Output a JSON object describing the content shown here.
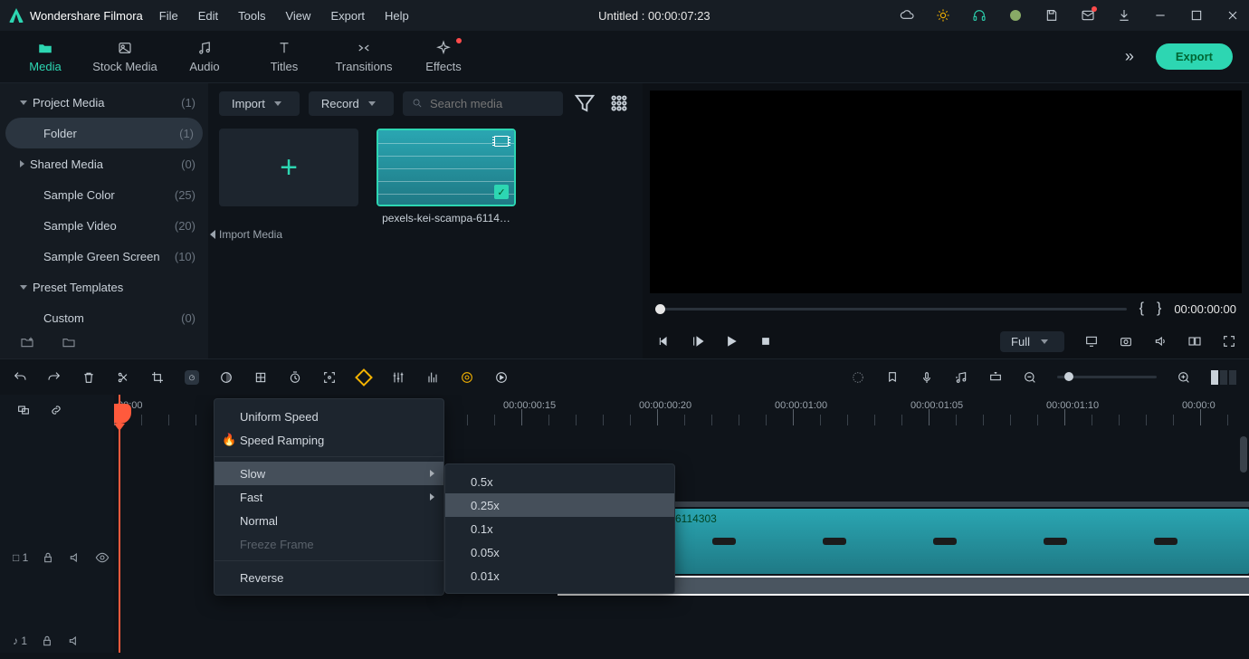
{
  "app_name": "Wondershare Filmora",
  "menubar": [
    "File",
    "Edit",
    "Tools",
    "View",
    "Export",
    "Help"
  ],
  "title": "Untitled : 00:00:07:23",
  "tabs": [
    {
      "label": "Media",
      "active": true
    },
    {
      "label": "Stock Media"
    },
    {
      "label": "Audio"
    },
    {
      "label": "Titles"
    },
    {
      "label": "Transitions"
    },
    {
      "label": "Effects",
      "dot": true
    }
  ],
  "export_label": "Export",
  "sidebar": [
    {
      "label": "Project Media",
      "count": "(1)",
      "caret": "down",
      "level": 1
    },
    {
      "label": "Folder",
      "count": "(1)",
      "level": 2,
      "active": true
    },
    {
      "label": "Shared Media",
      "count": "(0)",
      "caret": "right",
      "level": 1
    },
    {
      "label": "Sample Color",
      "count": "(25)",
      "level": 1,
      "pad": true
    },
    {
      "label": "Sample Video",
      "count": "(20)",
      "level": 1,
      "pad": true
    },
    {
      "label": "Sample Green Screen",
      "count": "(10)",
      "level": 1,
      "pad": true
    },
    {
      "label": "Preset Templates",
      "count": "",
      "caret": "down",
      "level": 1
    },
    {
      "label": "Custom",
      "count": "(0)",
      "level": 2
    }
  ],
  "media_bar": {
    "import": "Import",
    "record": "Record",
    "search_placeholder": "Search media"
  },
  "import_handle_label": "Import Media",
  "media_items": [
    {
      "kind": "import"
    },
    {
      "kind": "clip",
      "label": "pexels-kei-scampa-6114…",
      "selected": true
    }
  ],
  "preview": {
    "timecode": "00:00:00:00",
    "quality": "Full"
  },
  "ruler": {
    "start": "00:00",
    "labels": [
      "00:00:00:15",
      "00:00:00:20",
      "00:00:01:00",
      "00:00:01:05",
      "00:00:01:10",
      "00:00:0"
    ]
  },
  "clip_overlay_label": "6114303",
  "speed_menu": {
    "items": [
      {
        "label": "Uniform Speed"
      },
      {
        "label": "Speed Ramping",
        "icon": "fire"
      },
      {
        "sep": true
      },
      {
        "label": "Slow",
        "sub": true,
        "hl": true
      },
      {
        "label": "Fast",
        "sub": true
      },
      {
        "label": "Normal"
      },
      {
        "label": "Freeze Frame",
        "disabled": true
      },
      {
        "sep": true
      },
      {
        "label": "Reverse"
      }
    ],
    "slow_sub": [
      "0.5x",
      "0.25x",
      "0.1x",
      "0.05x",
      "0.01x"
    ],
    "slow_sub_hl": 1
  },
  "track_heads": {
    "video": "□ 1",
    "audio": "♪ 1"
  }
}
